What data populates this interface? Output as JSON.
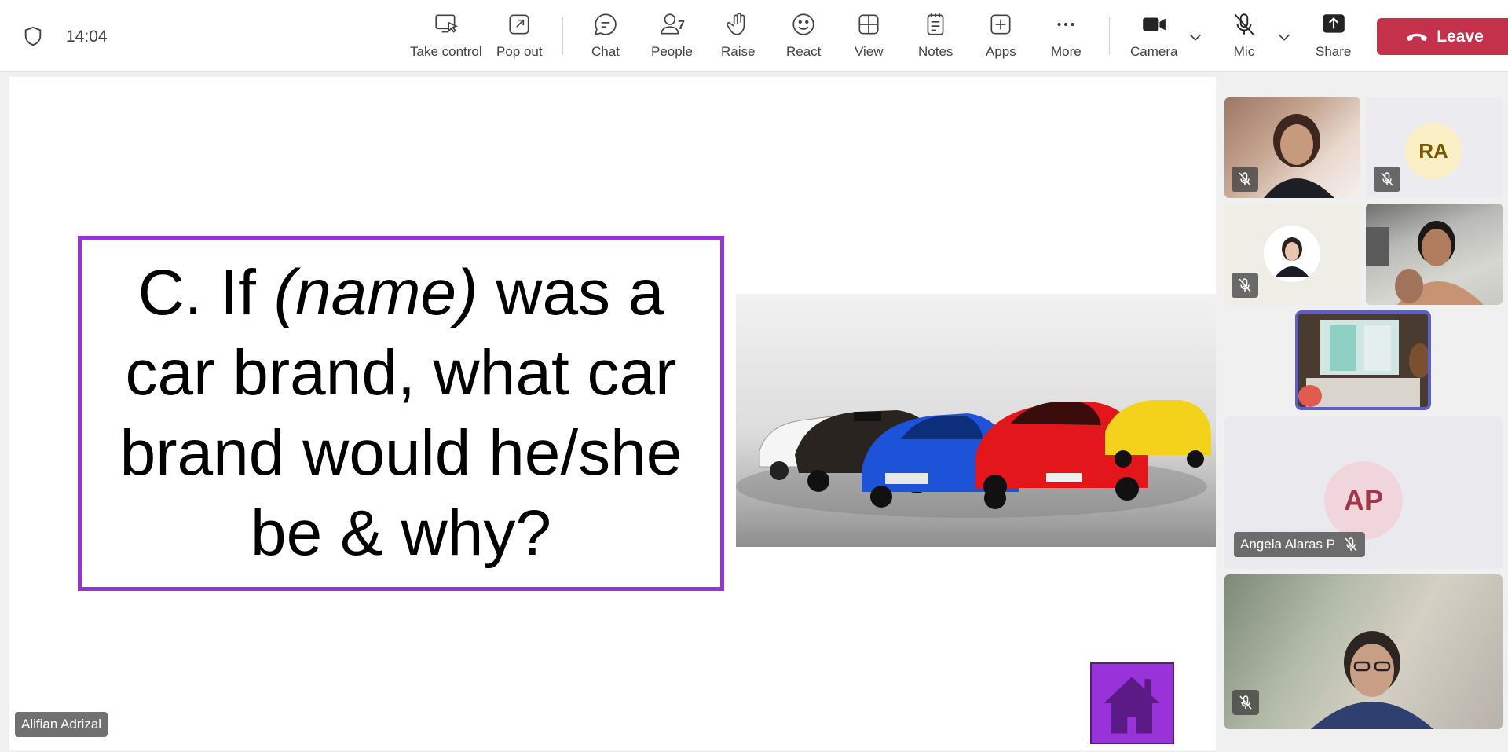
{
  "header": {
    "time": "14:04",
    "toolbar": {
      "take_control": "Take control",
      "pop_out": "Pop out",
      "chat": "Chat",
      "people": "People",
      "people_count": "7",
      "raise": "Raise",
      "react": "React",
      "view": "View",
      "notes": "Notes",
      "apps": "Apps",
      "more": "More",
      "camera": "Camera",
      "mic": "Mic",
      "share": "Share",
      "leave": "Leave"
    }
  },
  "slide": {
    "question_prefix": "C. If ",
    "question_name": "(name)",
    "question_suffix": " was a car brand, what car brand would he/she be & why?"
  },
  "presenter": {
    "name": "Alifian Adrizal"
  },
  "participants": [
    {
      "id": "p1",
      "muted": true
    },
    {
      "id": "p2",
      "initials": "RA",
      "muted": true
    },
    {
      "id": "p3",
      "muted": true
    },
    {
      "id": "p4",
      "muted": false
    },
    {
      "id": "self",
      "muted": false
    },
    {
      "id": "p6",
      "initials": "AP",
      "name": "Angela Alaras P",
      "muted": true
    },
    {
      "id": "p7",
      "muted": true
    }
  ],
  "colors": {
    "accent": "#9932d9",
    "leave": "#c4314b",
    "self_border": "#5b5fc7"
  }
}
